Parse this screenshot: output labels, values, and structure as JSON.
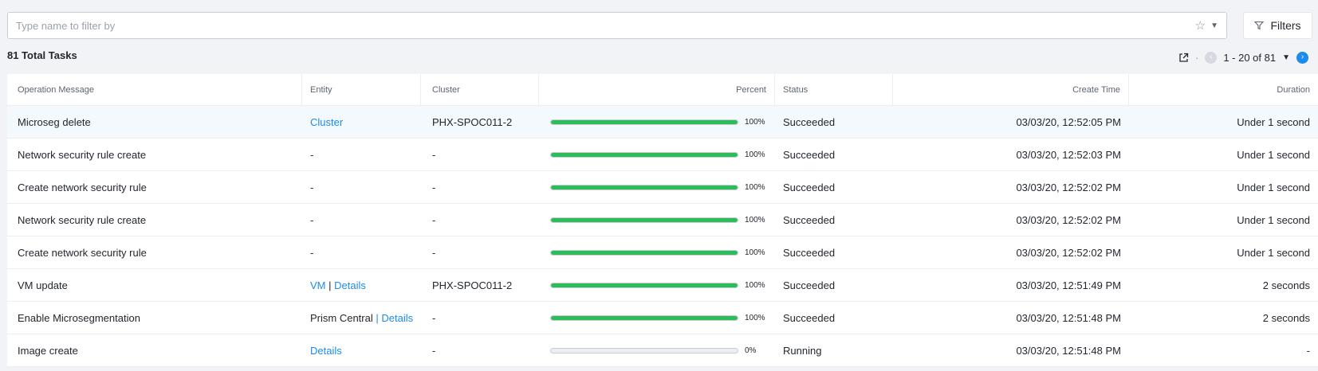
{
  "search": {
    "placeholder": "Type name to filter by"
  },
  "filters_label": "Filters",
  "summary": {
    "total_label": "81 Total Tasks"
  },
  "pagination": {
    "range": "1 - 20 of 81",
    "separator": "·"
  },
  "columns": {
    "operation": "Operation Message",
    "entity": "Entity",
    "cluster": "Cluster",
    "percent": "Percent",
    "status": "Status",
    "create_time": "Create Time",
    "duration": "Duration"
  },
  "rows": [
    {
      "operation": "Microseg delete",
      "entity_link": "Cluster",
      "cluster": "PHX-SPOC011-2",
      "percent_label": "100%",
      "progress": 1.0,
      "status": "Succeeded",
      "create_time": "03/03/20, 12:52:05 PM",
      "duration": "Under 1 second"
    },
    {
      "operation": "Network security rule create",
      "entity_text": "-",
      "cluster": "-",
      "percent_label": "100%",
      "progress": 1.0,
      "status": "Succeeded",
      "create_time": "03/03/20, 12:52:03 PM",
      "duration": "Under 1 second"
    },
    {
      "operation": "Create network security rule",
      "entity_text": "-",
      "cluster": "-",
      "percent_label": "100%",
      "progress": 1.0,
      "status": "Succeeded",
      "create_time": "03/03/20, 12:52:02 PM",
      "duration": "Under 1 second"
    },
    {
      "operation": "Network security rule create",
      "entity_text": "-",
      "cluster": "-",
      "percent_label": "100%",
      "progress": 1.0,
      "status": "Succeeded",
      "create_time": "03/03/20, 12:52:02 PM",
      "duration": "Under 1 second"
    },
    {
      "operation": "Create network security rule",
      "entity_text": "-",
      "cluster": "-",
      "percent_label": "100%",
      "progress": 1.0,
      "status": "Succeeded",
      "create_time": "03/03/20, 12:52:02 PM",
      "duration": "Under 1 second"
    },
    {
      "operation": "VM update",
      "entity_link": "VM",
      "entity_sep": "|",
      "entity_link2": "Details",
      "cluster": "PHX-SPOC011-2",
      "percent_label": "100%",
      "progress": 1.0,
      "status": "Succeeded",
      "create_time": "03/03/20, 12:51:49 PM",
      "duration": "2 seconds"
    },
    {
      "operation": "Enable Microsegmentation",
      "entity_text": "Prism Central",
      "entity_sep": "|",
      "entity_link2": "Details",
      "cluster": "-",
      "percent_label": "100%",
      "progress": 1.0,
      "status": "Succeeded",
      "create_time": "03/03/20, 12:51:48 PM",
      "duration": "2 seconds"
    },
    {
      "operation": "Image create",
      "entity_link": "Details",
      "cluster": "-",
      "percent_label": "0%",
      "progress": 0.0,
      "status": "Running",
      "create_time": "03/03/20, 12:51:48 PM",
      "duration": "-"
    }
  ],
  "colors": {
    "accent": "#1b8ceb",
    "progress": "#2bbd58"
  }
}
